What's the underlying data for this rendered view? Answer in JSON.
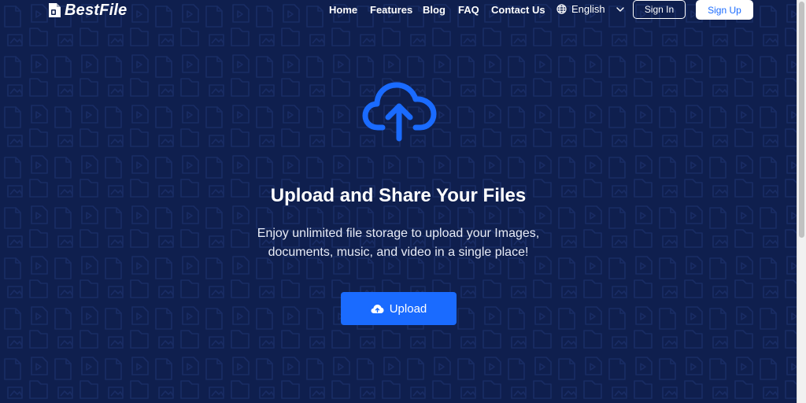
{
  "header": {
    "logo_text": "BestFile",
    "nav": {
      "home": "Home",
      "features": "Features",
      "blog": "Blog",
      "faq": "FAQ",
      "contact": "Contact Us"
    },
    "language": "English",
    "sign_in_label": "Sign In",
    "sign_up_label": "Sign Up"
  },
  "hero": {
    "icon": "cloud-upload-icon",
    "title": "Upload and Share Your Files",
    "subtitle_line1": "Enjoy unlimited file storage to upload your Images,",
    "subtitle_line2": "documents, music, and video in a single place!",
    "upload_label": "Upload"
  },
  "colors": {
    "background": "#0f1f4e",
    "accent": "#1a6bff",
    "text": "#ffffff"
  }
}
